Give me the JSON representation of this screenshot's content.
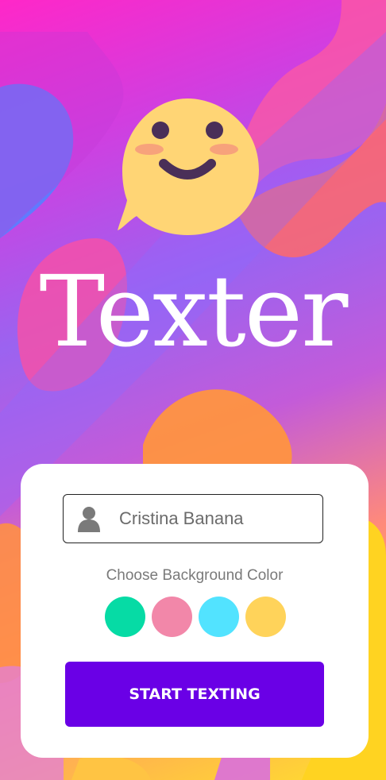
{
  "app": {
    "title": "Texter"
  },
  "name_input": {
    "value": "Cristina Banana",
    "icon": "user-icon"
  },
  "background_picker": {
    "label": "Choose Background Color",
    "colors": [
      "#06dba5",
      "#f287a9",
      "#52e3ff",
      "#ffd35a"
    ]
  },
  "start_button": {
    "label": "START TEXTING"
  },
  "theme": {
    "accent": "#6a00e6",
    "emoji_face": "#ffd575",
    "emoji_features": "#4a2f58",
    "emoji_cheeks": "#f7a27b"
  }
}
